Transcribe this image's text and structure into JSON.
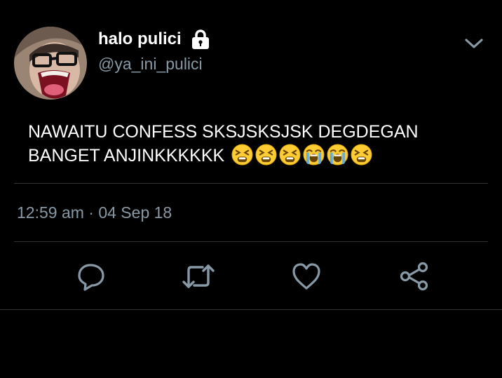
{
  "tweet": {
    "author": {
      "display_name": "halo pulici",
      "handle": "@ya_ini_pulici",
      "protected": true
    },
    "text": "NAWAITU CONFESS SKSJSKSJSK DEGDEGAN BANGET ANJINKKKKKK",
    "emojis": [
      "tired-face",
      "tired-face",
      "tired-face",
      "loudly-crying-face",
      "loudly-crying-face",
      "tired-face"
    ],
    "timestamp": "12:59 am · 04 Sep 18"
  },
  "actions": [
    "reply-icon",
    "retweet-icon",
    "like-icon",
    "share-icon"
  ],
  "colors": {
    "background": "#000000",
    "text": "#ffffff",
    "secondary": "#8899a6",
    "divider": "#2f3336",
    "emoji": "#ffcc33"
  }
}
